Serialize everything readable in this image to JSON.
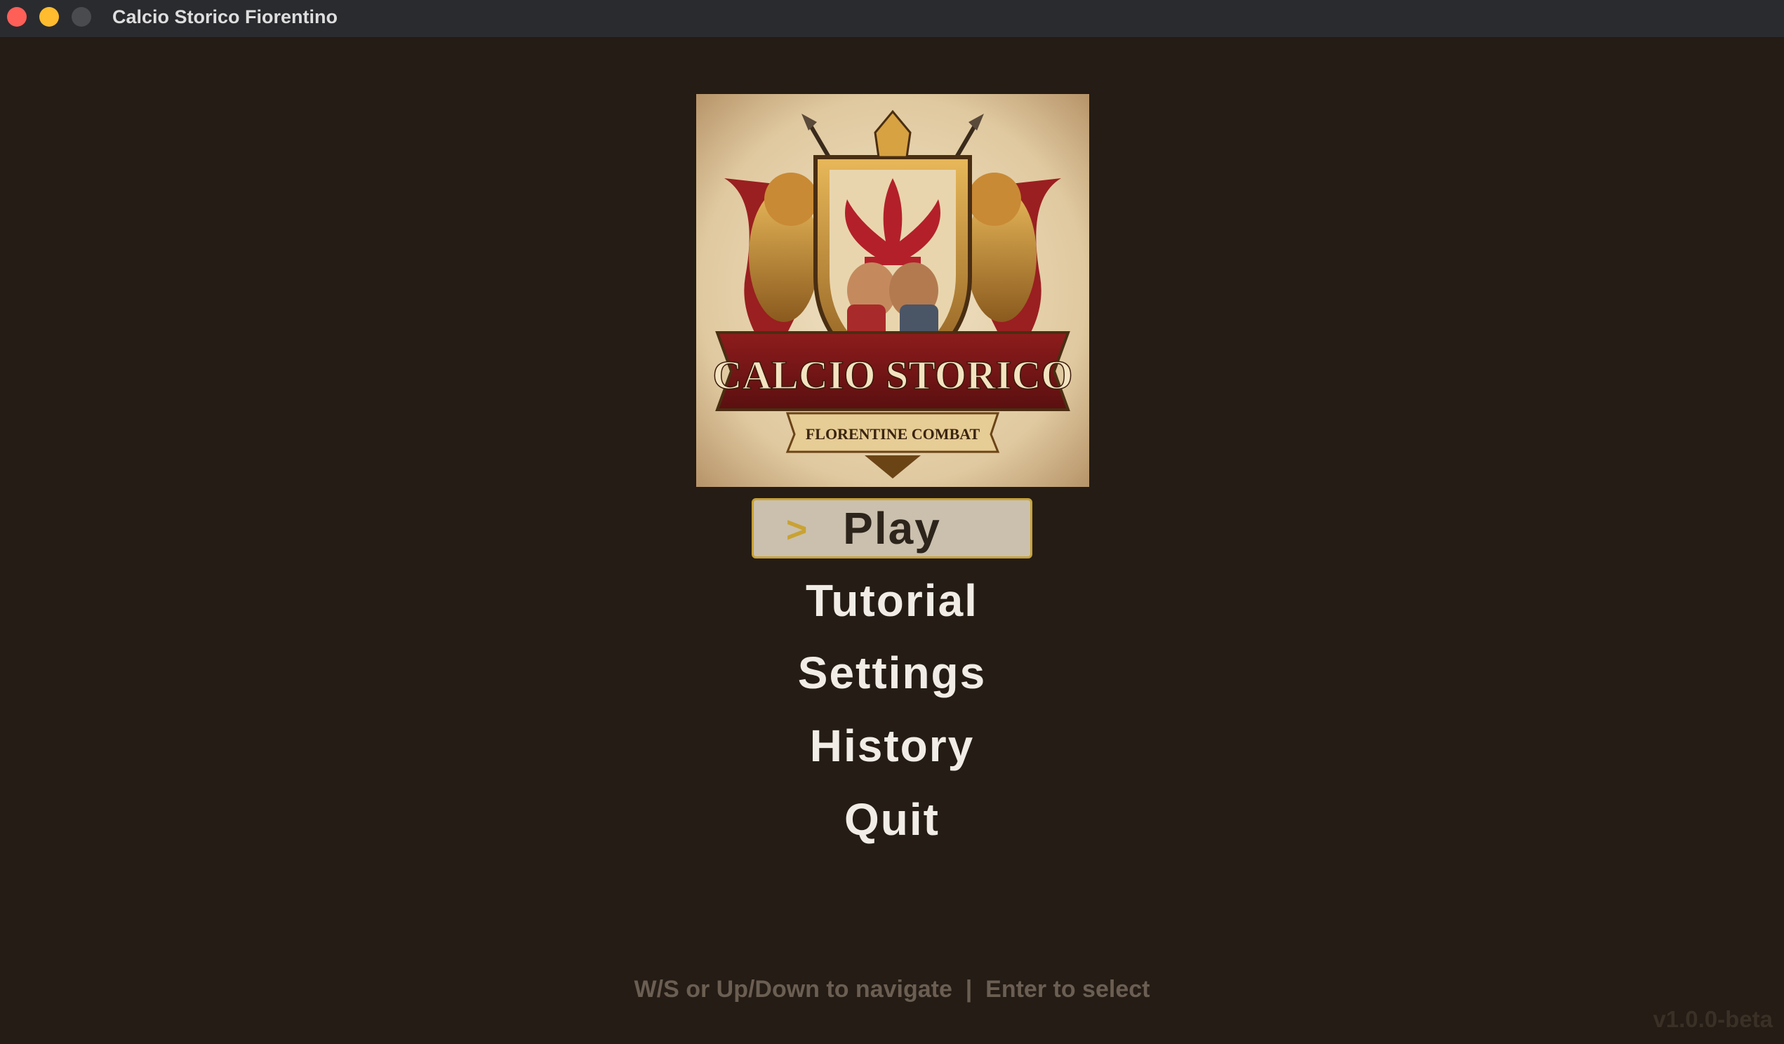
{
  "window": {
    "title": "Calcio Storico Fiorentino"
  },
  "colors": {
    "background": "#241c15",
    "selected_bg": "#cbc0ae",
    "selected_border": "#c9a233",
    "menu_text": "#f1ede6",
    "hint_text": "#6b5e52",
    "traffic_close": "#fe5f57",
    "traffic_min": "#febc2e",
    "traffic_max": "#4a4b4f"
  },
  "logo": {
    "title": "CALCIO STORICO",
    "subtitle": "FLORENTINE COMBAT"
  },
  "menu": {
    "selected_index": 0,
    "caret": ">",
    "items": [
      {
        "label": "Play"
      },
      {
        "label": "Tutorial"
      },
      {
        "label": "Settings"
      },
      {
        "label": "History"
      },
      {
        "label": "Quit"
      }
    ]
  },
  "footer": {
    "hint": "W/S or Up/Down to navigate  |  Enter to select",
    "version": "v1.0.0-beta"
  }
}
